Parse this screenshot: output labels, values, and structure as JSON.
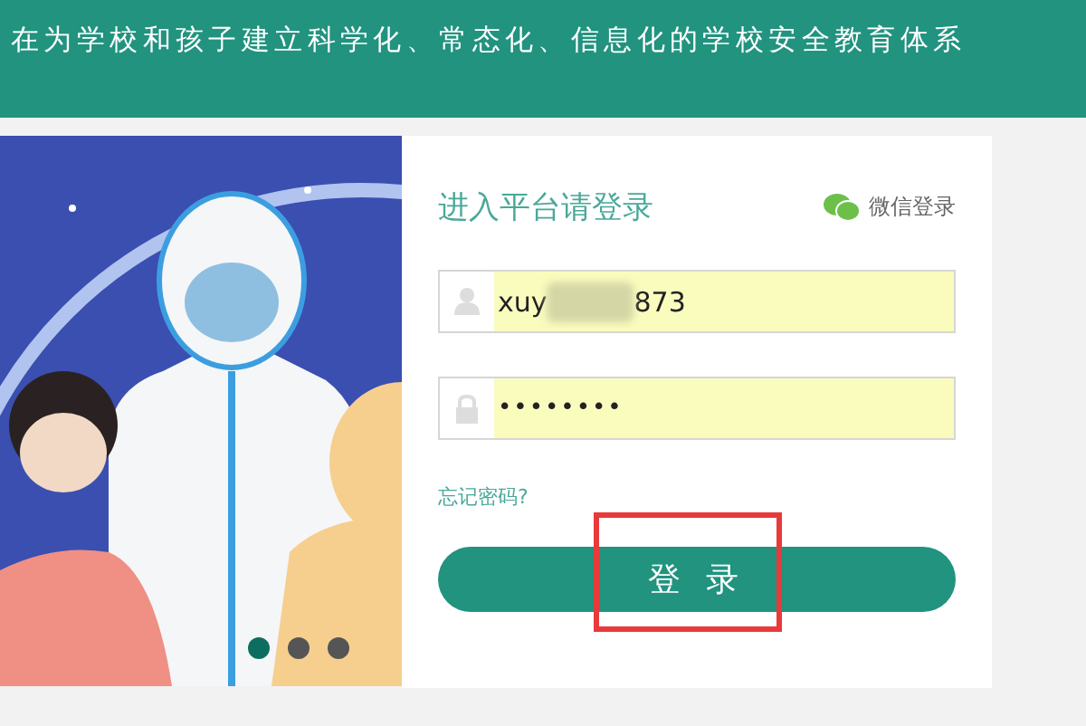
{
  "header": {
    "slogan": "在为学校和孩子建立科学化、常态化、信息化的学校安全教育体系"
  },
  "banner": {
    "kind": "picture",
    "dots": [
      {
        "selected": true
      },
      {
        "selected": false
      },
      {
        "selected": false
      }
    ]
  },
  "login": {
    "title": "进入平台请登录",
    "wechat_label": "微信登录",
    "username": {
      "value_start": "xuy",
      "value_end": "873",
      "blurred": true
    },
    "password": {
      "value": "••••••••"
    },
    "forgot_link": "忘记密码?",
    "submit": "登 录",
    "annotation": {
      "kind": "box",
      "color": "#e83a3a"
    }
  }
}
